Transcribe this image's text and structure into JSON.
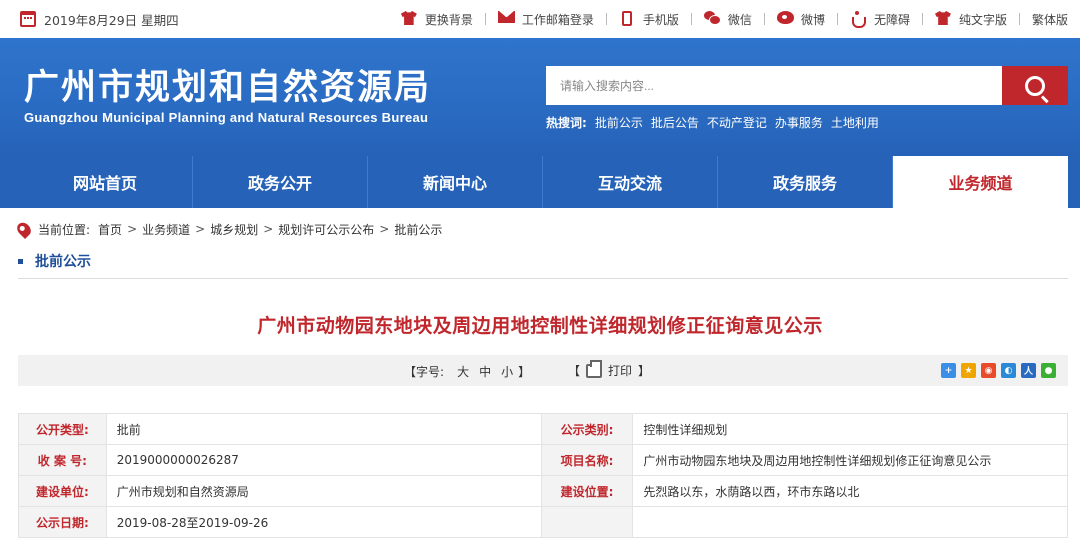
{
  "topbar": {
    "date": "2019年8月29日 星期四",
    "links": [
      {
        "label": "更换背景",
        "icon": "shirt-icon"
      },
      {
        "label": "工作邮箱登录",
        "icon": "mail-icon"
      },
      {
        "label": "手机版",
        "icon": "phone-icon"
      },
      {
        "label": "微信",
        "icon": "wechat-icon"
      },
      {
        "label": "微博",
        "icon": "weibo-icon"
      },
      {
        "label": "无障碍",
        "icon": "accessibility-icon"
      },
      {
        "label": "纯文字版",
        "icon": "shirt-icon"
      },
      {
        "label": "繁体版"
      }
    ]
  },
  "header": {
    "title": "广州市规划和自然资源局",
    "subtitle": "Guangzhou Municipal Planning and Natural Resources Bureau",
    "search_placeholder": "请输入搜索内容...",
    "hot_label": "热搜词:",
    "hot_words": [
      "批前公示",
      "批后公告",
      "不动产登记",
      "办事服务",
      "土地利用"
    ]
  },
  "nav": {
    "items": [
      "网站首页",
      "政务公开",
      "新闻中心",
      "互动交流",
      "政务服务",
      "业务频道"
    ],
    "active": "业务频道"
  },
  "breadcrumb": {
    "label": "当前位置:",
    "items": [
      "首页",
      "业务频道",
      "城乡规划",
      "规划许可公示公布",
      "批前公示"
    ],
    "separator": ">"
  },
  "section_title": "批前公示",
  "article": {
    "title": "广州市动物园东地块及周边用地控制性详细规划修正征询意见公示"
  },
  "toolbar": {
    "open_bracket": "【",
    "font_label": "字号:",
    "sizes": [
      "大",
      "中",
      "小"
    ],
    "close_bracket": "】",
    "print_label": "打印",
    "share_icons": [
      "share-qzone-icon",
      "share-favorite-icon",
      "share-weibo-icon",
      "share-qq-icon",
      "share-renren-icon",
      "share-wechat-icon"
    ]
  },
  "info": {
    "rows": [
      {
        "label1": "公开类型:",
        "value1": "批前",
        "label2": "公示类别:",
        "value2": "控制性详细规划"
      },
      {
        "label1": "收 案 号:",
        "value1": "2019000000026287",
        "label2": "项目名称:",
        "value2": "广州市动物园东地块及周边用地控制性详细规划修正征询意见公示"
      },
      {
        "label1": "建设单位:",
        "value1": "广州市规划和自然资源局",
        "label2": "建设位置:",
        "value2": "先烈路以东，水荫路以西，环市东路以北"
      },
      {
        "label1": "公示日期:",
        "value1": "2019-08-28至2019-09-26",
        "label2": "",
        "value2": ""
      }
    ]
  },
  "colors": {
    "brand_blue": "#2a6bc2",
    "accent_red": "#c0272d",
    "section_blue": "#1f4f99"
  }
}
